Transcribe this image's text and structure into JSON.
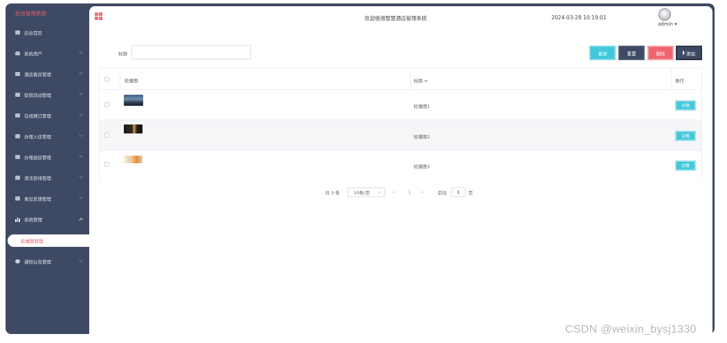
{
  "sidebar": {
    "brand": "后台管理系统",
    "items": [
      {
        "label": "后台首页"
      },
      {
        "label": "系统用户"
      },
      {
        "label": "酒店客房管理"
      },
      {
        "label": "促销活动管理"
      },
      {
        "label": "在线预订管理"
      },
      {
        "label": "办理入住管理"
      },
      {
        "label": "办理退房管理"
      },
      {
        "label": "清洁安排管理"
      },
      {
        "label": "意见反馈管理"
      },
      {
        "label": "系统管理"
      },
      {
        "label": "通知公告管理"
      }
    ],
    "active_sub": "轮播图管理"
  },
  "header": {
    "welcome": "欢迎使用智慧酒店管理系统",
    "datetime": "2024-03-28 10:19:01",
    "user": "admin ▾"
  },
  "search": {
    "label": "标题",
    "value": ""
  },
  "toolbar": {
    "search": "查询",
    "reset": "重置",
    "delete": "删除",
    "add": "添加"
  },
  "table": {
    "headers": {
      "image": "轮播图",
      "title": "标题 ≑",
      "action": "操作"
    },
    "rows": [
      {
        "title": "轮播图1",
        "action": "详情"
      },
      {
        "title": "轮播图2",
        "action": "详情"
      },
      {
        "title": "轮播图3",
        "action": "详情"
      }
    ]
  },
  "pagination": {
    "total": "共 3 条",
    "page_size": "10条/页",
    "prev": "<",
    "current": "1",
    "next": ">",
    "goto_label": "前往",
    "goto_value": "1",
    "page_suffix": "页"
  },
  "watermark": "CSDN @weixin_bysj1330",
  "colors": {
    "sidebar_bg": "#3e4a63",
    "accent_red": "#e8606b",
    "accent_cyan": "#41c9dc"
  }
}
